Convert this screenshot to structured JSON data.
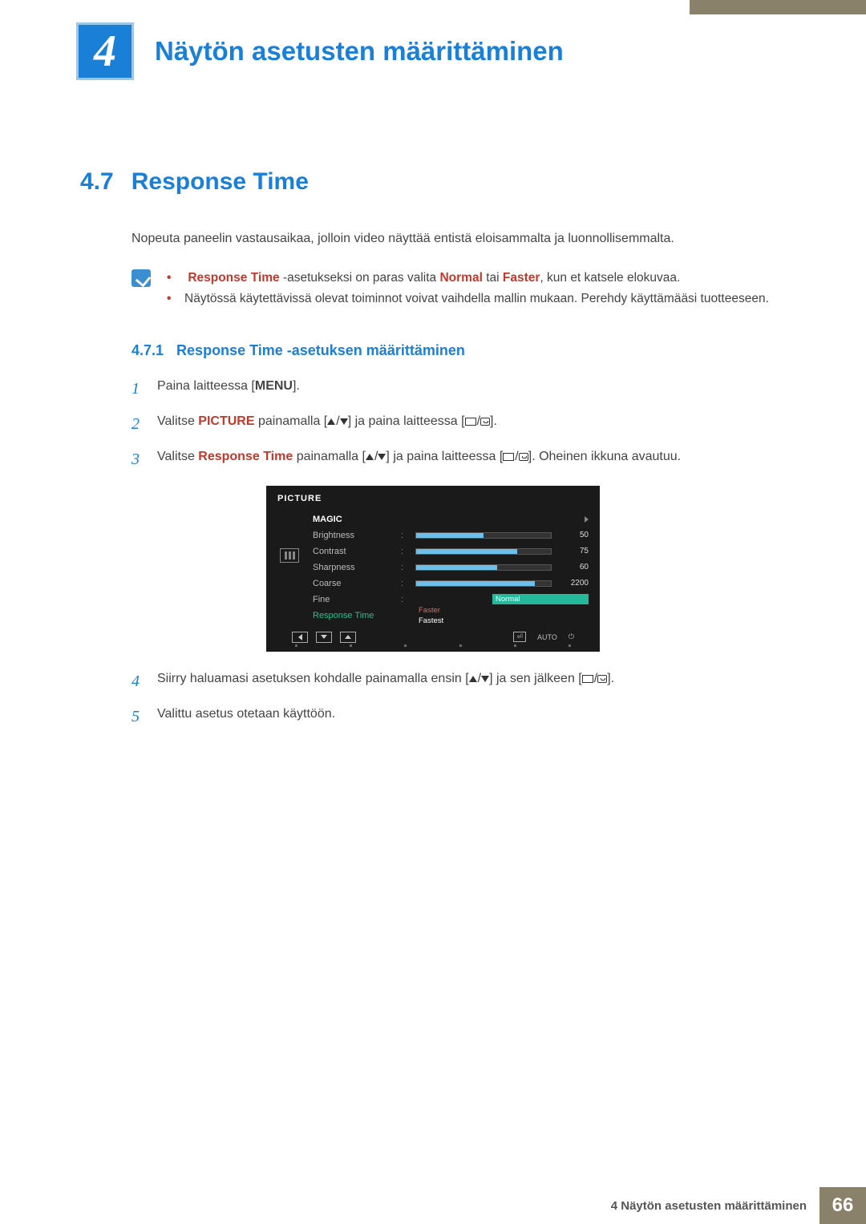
{
  "chapter": {
    "number": "4",
    "title": "Näytön asetusten määrittäminen"
  },
  "section": {
    "number": "4.7",
    "title": "Response Time",
    "intro": "Nopeuta paneelin vastausaikaa, jolloin video näyttää entistä eloisammalta ja luonnollisemmalta."
  },
  "notes": {
    "item1_part1": "Response Time",
    "item1_part2": " -asetukseksi on paras valita ",
    "item1_part3": "Normal",
    "item1_part4": " tai ",
    "item1_part5": "Faster",
    "item1_part6": ", kun et katsele elokuvaa.",
    "item2": "Näytössä käytettävissä olevat toiminnot voivat vaihdella mallin mukaan. Perehdy käyttämääsi tuotteeseen."
  },
  "subsection": {
    "number": "4.7.1",
    "title": "Response Time -asetuksen määrittäminen"
  },
  "steps": {
    "s1_num": "1",
    "s1_text_a": "Paina laitteessa [",
    "s1_menu": "MENU",
    "s1_text_b": "].",
    "s2_num": "2",
    "s2_text_a": "Valitse ",
    "s2_picture": "PICTURE",
    "s2_text_b": " painamalla [",
    "s2_text_c": "] ja paina laitteessa [",
    "s2_text_d": "].",
    "s3_num": "3",
    "s3_text_a": "Valitse ",
    "s3_rt": "Response Time",
    "s3_text_b": " painamalla [",
    "s3_text_c": "] ja paina laitteessa [",
    "s3_text_d": "]. Oheinen ikkuna avautuu.",
    "s4_num": "4",
    "s4_text_a": "Siirry haluamasi asetuksen kohdalle painamalla ensin [",
    "s4_text_b": "] ja sen jälkeen [",
    "s4_text_c": "].",
    "s5_num": "5",
    "s5_text": "Valittu asetus otetaan käyttöön."
  },
  "osd": {
    "title": "PICTURE",
    "magic": "MAGIC",
    "brightness": "Brightness",
    "brightness_val": "50",
    "contrast": "Contrast",
    "contrast_val": "75",
    "sharpness": "Sharpness",
    "sharpness_val": "60",
    "coarse": "Coarse",
    "coarse_val": "2200",
    "fine": "Fine",
    "response_time": "Response Time",
    "opt_normal": "Normal",
    "opt_faster": "Faster",
    "opt_fastest": "Fastest",
    "auto": "AUTO"
  },
  "footer": {
    "text": "4 Näytön asetusten määrittäminen",
    "page": "66"
  }
}
